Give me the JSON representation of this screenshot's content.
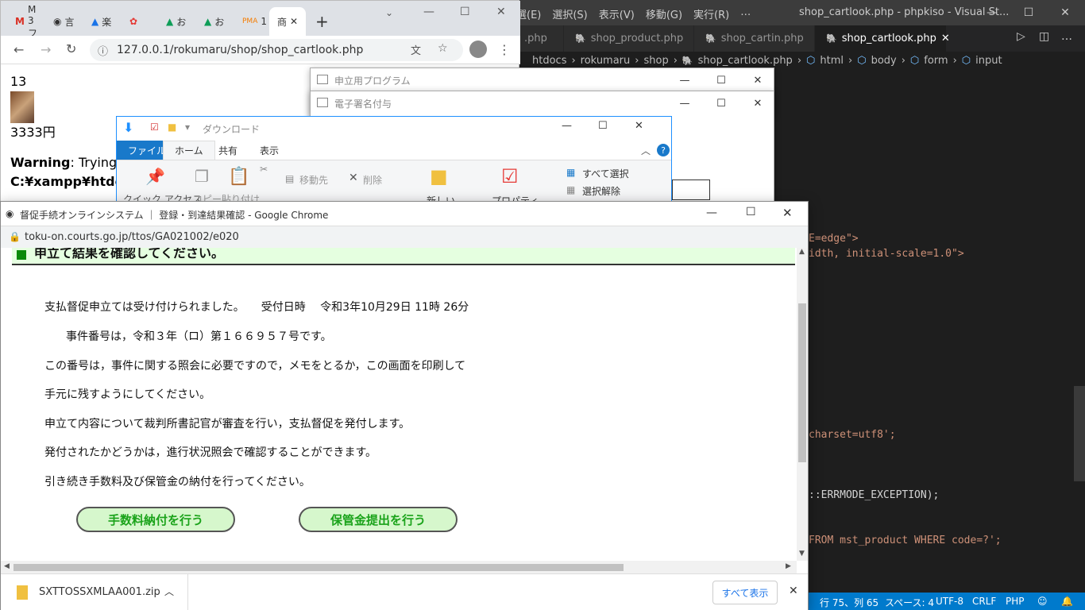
{
  "vscode": {
    "menu": [
      "選(E)",
      "選択(S)",
      "表示(V)",
      "移動(G)",
      "実行(R)",
      "…"
    ],
    "title": "shop_cartlook.php - phpkiso - Visual St...",
    "tabs": [
      ".php",
      "shop_product.php",
      "shop_cartin.php",
      "shop_cartlook.php"
    ],
    "breadcrumb": [
      "htdocs",
      "rokumaru",
      "shop",
      "shop_cartlook.php",
      "html",
      "body",
      "form",
      "input"
    ],
    "code_lines": [
      {
        "text": "E=edge\">"
      },
      {
        "text": "idth, initial-scale=1.0\">"
      },
      {
        "text": "charset=utf8';"
      },
      {
        "text": "::ERRMODE_EXCEPTION);"
      },
      {
        "text": "FROM mst_product WHERE code=?';"
      }
    ],
    "status": {
      "position": "行 75、列 65",
      "spaces": "スペース: 4",
      "encoding": "UTF-8",
      "eol": "CRLF",
      "language": "PHP"
    }
  },
  "chrome1": {
    "url": "127.0.0.1/rokumaru/shop/shop_cartlook.php",
    "tab_labels": [
      "M 3 フ",
      "言",
      "楽",
      "",
      "お",
      "お",
      "1",
      "商"
    ],
    "content": {
      "qty": "13",
      "price": "3333円",
      "warning_label": "Warning",
      "warning_text": ": Trying",
      "path": "C:¥xampp¥htdo"
    }
  },
  "small_windows": {
    "w1_title": "申立用プログラム",
    "w2_title": "電子署名付与"
  },
  "explorer": {
    "title": "ダウンロード",
    "tabs": [
      "ファイル",
      "ホーム",
      "共有",
      "表示"
    ],
    "ribbon": {
      "move_to": "移動先",
      "delete": "削除",
      "select_all": "すべて選択",
      "deselect": "選択解除",
      "quick_access": "クイック アクセス",
      "copy": "コピー",
      "paste": "貼り付け",
      "new": "新しい",
      "properties": "プロパティ"
    }
  },
  "chrome2": {
    "title": "督促手続オンラインシステム ｜ 登録・到達結果確認 - Google Chrome",
    "url": "toku-on.courts.go.jp/ttos/GA021002/e020",
    "banner": "申立て結果を確認してください。",
    "lines": {
      "l1": "支払督促申立ては受け付けられました。　　受付日時　 令和3年10月29日 11時 26分",
      "l2": "事件番号は，令和３年（ロ）第１６６９５７号です。",
      "l3": "この番号は，事件に関する照会に必要ですので，メモをとるか，この画面を印刷して",
      "l4": "手元に残すようにしてください。",
      "l5": "申立て内容について裁判所書記官が審査を行い，支払督促を発付します。",
      "l6": "発付されたかどうかは，進行状況照会で確認することができます。",
      "l7": "引き続き手数料及び保管金の納付を行ってください。"
    },
    "btn_fee": "手数料納付を行う",
    "btn_deposit": "保管金提出を行う",
    "download_file": "SXTTOSSXMLAA001.zip",
    "show_all": "すべて表示"
  }
}
